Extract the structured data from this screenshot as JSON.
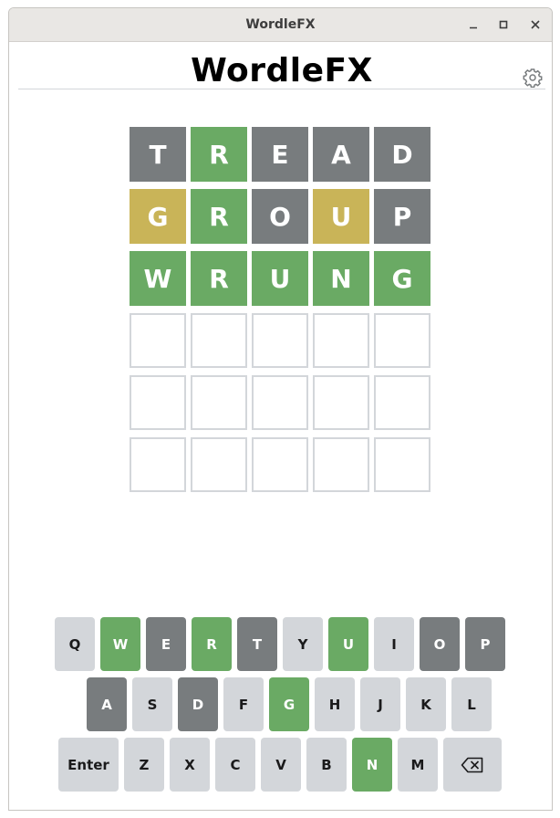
{
  "window": {
    "title": "WordleFX"
  },
  "app": {
    "title": "WordleFX"
  },
  "colors": {
    "green": "#6aaa64",
    "yellow": "#c9b458",
    "gray": "#787c7e",
    "unused": "#d3d6da",
    "empty_border": "#d3d6da"
  },
  "board": {
    "rows": [
      [
        {
          "letter": "T",
          "state": "gray"
        },
        {
          "letter": "R",
          "state": "green"
        },
        {
          "letter": "E",
          "state": "gray"
        },
        {
          "letter": "A",
          "state": "gray"
        },
        {
          "letter": "D",
          "state": "gray"
        }
      ],
      [
        {
          "letter": "G",
          "state": "yellow"
        },
        {
          "letter": "R",
          "state": "green"
        },
        {
          "letter": "O",
          "state": "gray"
        },
        {
          "letter": "U",
          "state": "yellow"
        },
        {
          "letter": "P",
          "state": "gray"
        }
      ],
      [
        {
          "letter": "W",
          "state": "green"
        },
        {
          "letter": "R",
          "state": "green"
        },
        {
          "letter": "U",
          "state": "green"
        },
        {
          "letter": "N",
          "state": "green"
        },
        {
          "letter": "G",
          "state": "green"
        }
      ],
      [
        {
          "letter": "",
          "state": "empty"
        },
        {
          "letter": "",
          "state": "empty"
        },
        {
          "letter": "",
          "state": "empty"
        },
        {
          "letter": "",
          "state": "empty"
        },
        {
          "letter": "",
          "state": "empty"
        }
      ],
      [
        {
          "letter": "",
          "state": "empty"
        },
        {
          "letter": "",
          "state": "empty"
        },
        {
          "letter": "",
          "state": "empty"
        },
        {
          "letter": "",
          "state": "empty"
        },
        {
          "letter": "",
          "state": "empty"
        }
      ],
      [
        {
          "letter": "",
          "state": "empty"
        },
        {
          "letter": "",
          "state": "empty"
        },
        {
          "letter": "",
          "state": "empty"
        },
        {
          "letter": "",
          "state": "empty"
        },
        {
          "letter": "",
          "state": "empty"
        }
      ]
    ]
  },
  "keyboard": {
    "rows": [
      [
        {
          "label": "Q",
          "state": "unused"
        },
        {
          "label": "W",
          "state": "green"
        },
        {
          "label": "E",
          "state": "gray"
        },
        {
          "label": "R",
          "state": "green"
        },
        {
          "label": "T",
          "state": "gray"
        },
        {
          "label": "Y",
          "state": "unused"
        },
        {
          "label": "U",
          "state": "green"
        },
        {
          "label": "I",
          "state": "unused"
        },
        {
          "label": "O",
          "state": "gray"
        },
        {
          "label": "P",
          "state": "gray"
        }
      ],
      [
        {
          "label": "A",
          "state": "gray"
        },
        {
          "label": "S",
          "state": "unused"
        },
        {
          "label": "D",
          "state": "gray"
        },
        {
          "label": "F",
          "state": "unused"
        },
        {
          "label": "G",
          "state": "green"
        },
        {
          "label": "H",
          "state": "unused"
        },
        {
          "label": "J",
          "state": "unused"
        },
        {
          "label": "K",
          "state": "unused"
        },
        {
          "label": "L",
          "state": "unused"
        }
      ],
      [
        {
          "label": "Enter",
          "state": "unused",
          "special": "enter"
        },
        {
          "label": "Z",
          "state": "unused"
        },
        {
          "label": "X",
          "state": "unused"
        },
        {
          "label": "C",
          "state": "unused"
        },
        {
          "label": "V",
          "state": "unused"
        },
        {
          "label": "B",
          "state": "unused"
        },
        {
          "label": "N",
          "state": "green"
        },
        {
          "label": "M",
          "state": "unused"
        },
        {
          "label": "",
          "state": "unused",
          "special": "backspace",
          "icon": "backspace-icon"
        }
      ]
    ]
  },
  "icons": {
    "settings": "gear-icon",
    "minimize": "minimize-icon",
    "maximize": "maximize-icon",
    "close": "close-icon"
  }
}
